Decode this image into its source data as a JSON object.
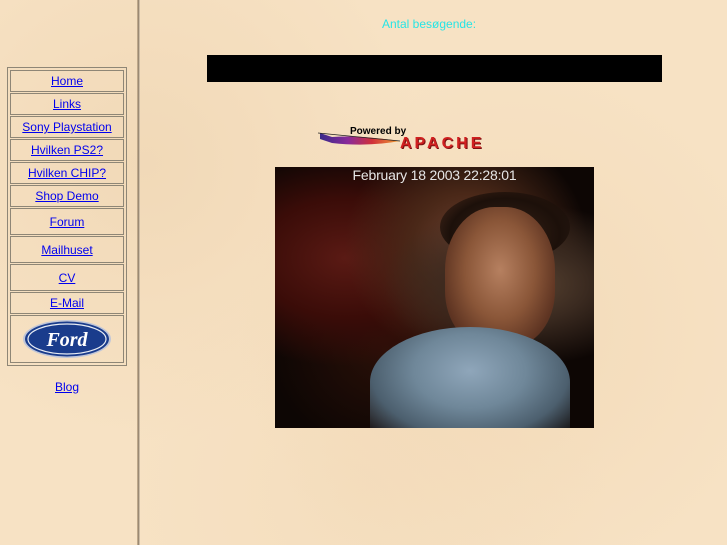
{
  "visitors_label": "Antal besøgende:",
  "nav": {
    "items": [
      {
        "label": "Home"
      },
      {
        "label": "Links"
      },
      {
        "label": "Sony Playstation"
      },
      {
        "label": "Hvilken PS2?"
      },
      {
        "label": "Hvilken CHIP?"
      },
      {
        "label": "Shop Demo"
      },
      {
        "label": "Forum"
      },
      {
        "label": "Mailhuset"
      },
      {
        "label": "CV"
      },
      {
        "label": "E-Mail"
      }
    ],
    "logo_text": "Ford",
    "blog_label": "Blog"
  },
  "apache": {
    "powered_text": "Powered by",
    "word": "APACHE"
  },
  "webcam": {
    "timestamp": "February 18 2003 22:28:01"
  },
  "colors": {
    "background": "#f7e2c4",
    "link": "#0000ee",
    "visitors_text": "#27e5e5",
    "ford_blue": "#1a3c8c"
  }
}
